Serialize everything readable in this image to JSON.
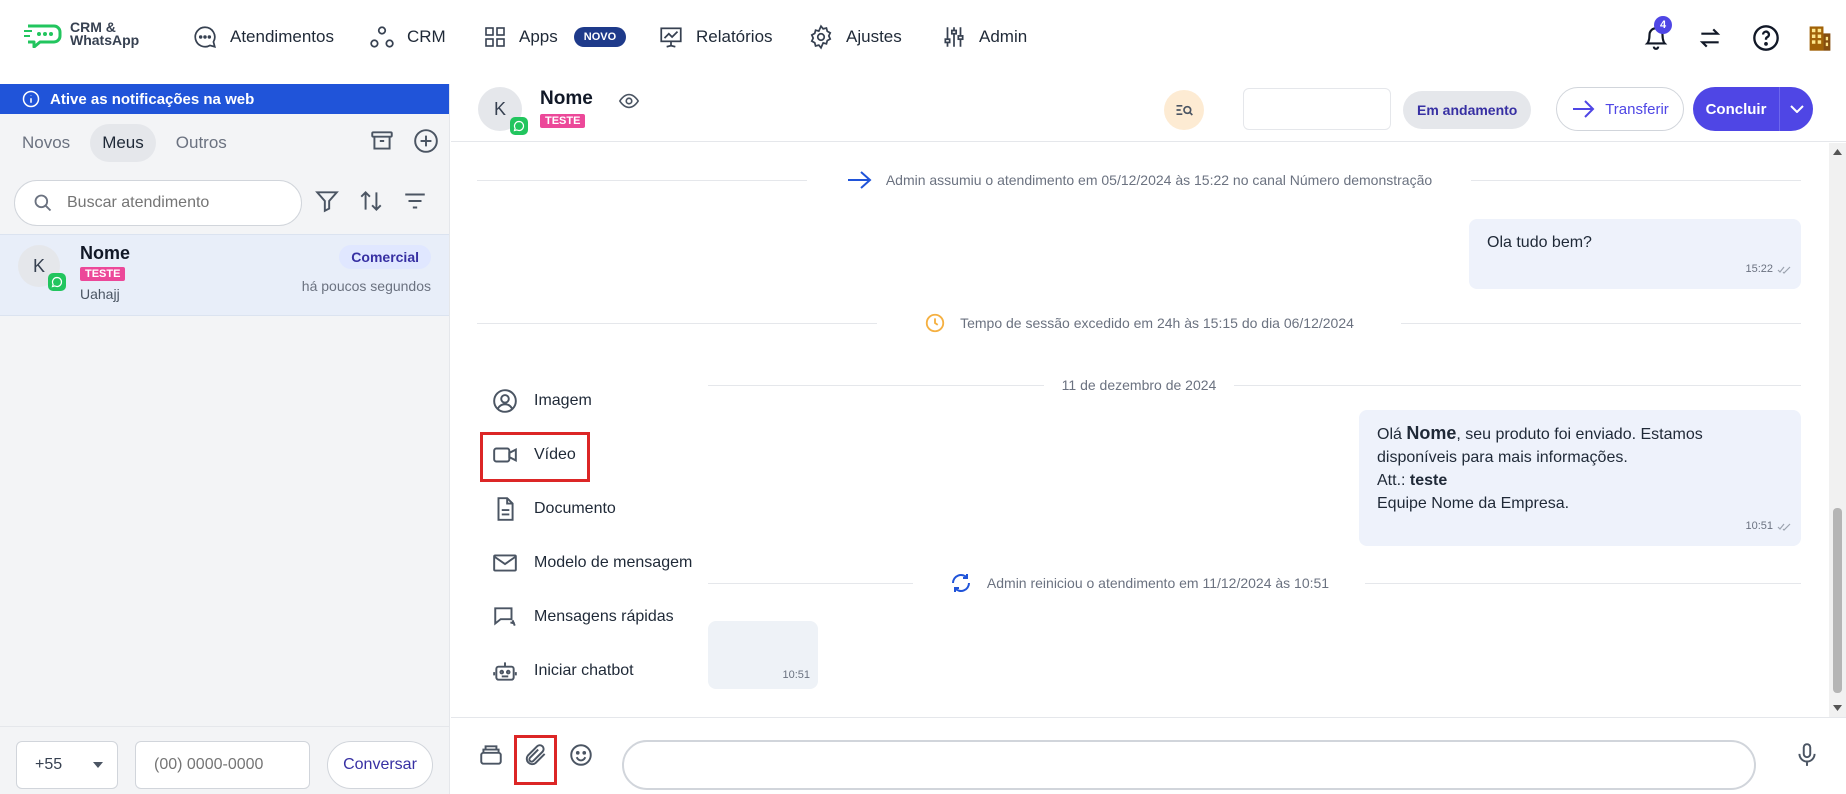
{
  "app": {
    "brand_line1": "CRM &",
    "brand_line2": "WhatsApp"
  },
  "nav": {
    "atendimentos": "Atendimentos",
    "crm": "CRM",
    "apps": "Apps",
    "apps_badge": "NOVO",
    "relatorios": "Relatórios",
    "ajustes": "Ajustes",
    "admin": "Admin"
  },
  "notifications": {
    "count": "4"
  },
  "left": {
    "banner": "Ative as notificações na web",
    "tabs": [
      "Novos",
      "Meus",
      "Outros"
    ],
    "search_placeholder": "Buscar atendimento",
    "conversation": {
      "avatar_letter": "K",
      "name": "Nome",
      "tag": "TESTE",
      "department": "Comercial",
      "time": "há poucos segundos",
      "last_message": "Uahajj"
    },
    "ddi": "+55",
    "phone_placeholder": "(00) 0000-0000",
    "conversar": "Conversar"
  },
  "header": {
    "avatar_letter": "K",
    "name": "Nome",
    "tag": "TESTE",
    "status": "Em andamento",
    "transferir": "Transferir",
    "concluir": "Concluir"
  },
  "chat": {
    "sys1": "Admin assumiu o atendimento em 05/12/2024 às 15:22 no canal Número demonstração",
    "msg1": {
      "text": "Ola tudo bem?",
      "time": "15:22"
    },
    "sys2": "Tempo de sessão excedido em 24h às 15:15 do dia 06/12/2024",
    "date_sep": "11 de dezembro de 2024",
    "msg2": {
      "p1": "Olá ",
      "p1b": "Nome",
      "p2": ", seu produto foi enviado. Estamos",
      "line2": "disponíveis para mais informações.",
      "line3a": "Att.: ",
      "line3b": "teste",
      "line4": "Equipe Nome da Empresa.",
      "time": "10:51"
    },
    "sys3": "Admin reiniciou o atendimento em 11/12/2024 às 10:51",
    "msg3": {
      "time": "10:51"
    }
  },
  "attach_menu": {
    "imagem": "Imagem",
    "video": "Vídeo",
    "documento": "Documento",
    "modelo": "Modelo de mensagem",
    "rapidas": "Mensagens rápidas",
    "chatbot": "Iniciar chatbot"
  }
}
